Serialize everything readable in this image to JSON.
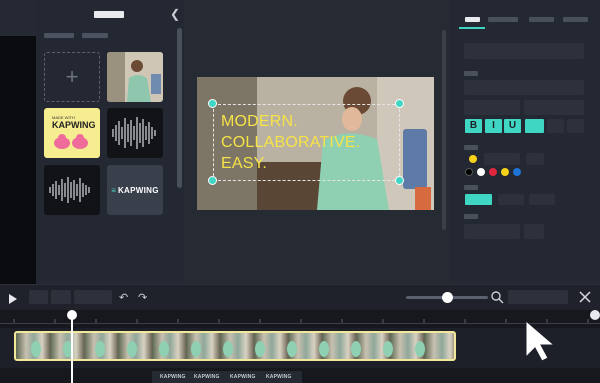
{
  "canvas": {
    "headline_line1": "MODERN.",
    "headline_line2": "COLLABORATIVE.",
    "headline_line3": "EASY."
  },
  "media": {
    "upload_icon": "plus-icon",
    "tiles": [
      {
        "kind": "upload"
      },
      {
        "kind": "photo"
      },
      {
        "kind": "kapwing-yellow",
        "small_text": "MADE WITH",
        "big_text": "KAPWING"
      },
      {
        "kind": "audio-waveform"
      },
      {
        "kind": "audio-waveform"
      },
      {
        "kind": "kapwing-logo",
        "text": "KAPWING"
      }
    ]
  },
  "properties": {
    "format_buttons": [
      "B",
      "I",
      "U"
    ],
    "swatches_row1": [
      "#f7d21a"
    ],
    "swatches_row2": [
      "#000000",
      "#ffffff",
      "#e0263c",
      "#f7d21a",
      "#1e73d6"
    ],
    "accent": "#40d6c4"
  },
  "footer": {
    "logos": [
      "KAPWING",
      "KAPWING",
      "KAPWING",
      "KAPWING"
    ]
  }
}
